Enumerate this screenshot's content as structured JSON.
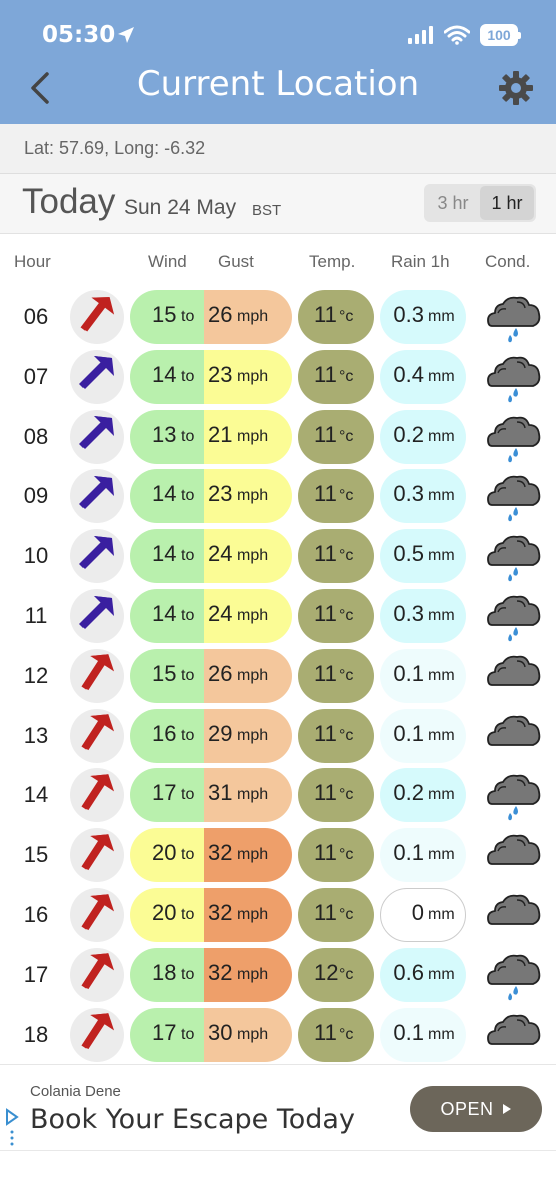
{
  "status_bar": {
    "time": "05:30",
    "battery": "100"
  },
  "header": {
    "title": "Current Location"
  },
  "location": {
    "latlong": "Lat: 57.69, Long: -6.32"
  },
  "date_bar": {
    "today": "Today",
    "date": "Sun 24 May",
    "tz": "BST",
    "toggle": [
      "3 hr",
      "1 hr"
    ],
    "active_toggle": "1 hr"
  },
  "columns": {
    "hour": "Hour",
    "wind": "Wind",
    "gust": "Gust",
    "temp": "Temp.",
    "rain": "Rain 1h",
    "cond": "Cond."
  },
  "units": {
    "to": "to",
    "mph": "mph",
    "degc": "°c",
    "mm": "mm"
  },
  "colors": {
    "green": "#b9f0ad",
    "yellow": "#fbfc95",
    "peach": "#f4c79c",
    "orange": "#ee9f6a",
    "temp": "#a9ad72",
    "rain_strong": "#d6fafc",
    "rain_light": "#eefcfd",
    "rain_zero": "#ffffff",
    "arrow_red": "#c0221f",
    "arrow_blue": "#3a1fa0"
  },
  "rows": [
    {
      "hour": "06",
      "wind": "15",
      "gust": "26",
      "temp": "11",
      "rain": "0.3",
      "dir_icon": "arrow-northeast-red-icon",
      "cond_icon": "cloud-rain-icon"
    },
    {
      "hour": "07",
      "wind": "14",
      "gust": "23",
      "temp": "11",
      "rain": "0.4",
      "dir_icon": "arrow-northeast-blue-icon",
      "cond_icon": "cloud-rain-icon"
    },
    {
      "hour": "08",
      "wind": "13",
      "gust": "21",
      "temp": "11",
      "rain": "0.2",
      "dir_icon": "arrow-northeast-blue-icon",
      "cond_icon": "cloud-rain-icon"
    },
    {
      "hour": "09",
      "wind": "14",
      "gust": "23",
      "temp": "11",
      "rain": "0.3",
      "dir_icon": "arrow-northeast-blue-icon",
      "cond_icon": "cloud-rain-icon"
    },
    {
      "hour": "10",
      "wind": "14",
      "gust": "24",
      "temp": "11",
      "rain": "0.5",
      "dir_icon": "arrow-northeast-blue-icon",
      "cond_icon": "cloud-rain-icon"
    },
    {
      "hour": "11",
      "wind": "14",
      "gust": "24",
      "temp": "11",
      "rain": "0.3",
      "dir_icon": "arrow-northeast-blue-icon",
      "cond_icon": "cloud-rain-icon"
    },
    {
      "hour": "12",
      "wind": "15",
      "gust": "26",
      "temp": "11",
      "rain": "0.1",
      "dir_icon": "arrow-north-red-icon",
      "cond_icon": "cloud-icon"
    },
    {
      "hour": "13",
      "wind": "16",
      "gust": "29",
      "temp": "11",
      "rain": "0.1",
      "dir_icon": "arrow-north-red-icon",
      "cond_icon": "cloud-icon"
    },
    {
      "hour": "14",
      "wind": "17",
      "gust": "31",
      "temp": "11",
      "rain": "0.2",
      "dir_icon": "arrow-north-red-icon",
      "cond_icon": "cloud-rain-icon"
    },
    {
      "hour": "15",
      "wind": "20",
      "gust": "32",
      "temp": "11",
      "rain": "0.1",
      "dir_icon": "arrow-north-red-icon",
      "cond_icon": "cloud-icon"
    },
    {
      "hour": "16",
      "wind": "20",
      "gust": "32",
      "temp": "11",
      "rain": "0",
      "dir_icon": "arrow-north-red-icon",
      "cond_icon": "cloud-icon"
    },
    {
      "hour": "17",
      "wind": "18",
      "gust": "32",
      "temp": "12",
      "rain": "0.6",
      "dir_icon": "arrow-north-red-icon",
      "cond_icon": "cloud-rain-icon"
    },
    {
      "hour": "18",
      "wind": "17",
      "gust": "30",
      "temp": "11",
      "rain": "0.1",
      "dir_icon": "arrow-north-red-icon",
      "cond_icon": "cloud-icon"
    }
  ],
  "ad": {
    "sponsor": "Colania Dene",
    "headline": "Book Your Escape Today",
    "button": "OPEN"
  }
}
